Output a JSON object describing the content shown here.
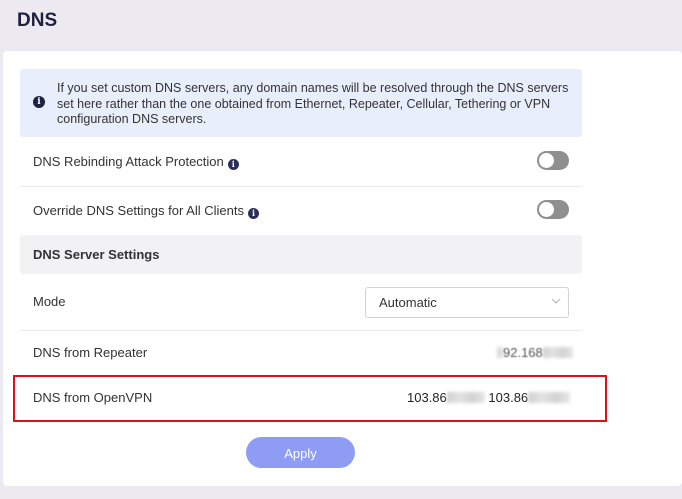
{
  "page": {
    "title": "DNS"
  },
  "info": {
    "icon": "info-circle-icon",
    "lines": [
      "If you set custom DNS servers, any domain names will be resolved through the DNS servers",
      "set here rather than the one obtained from Ethernet, Repeater, Cellular, Tethering or VPN",
      "configuration DNS servers."
    ]
  },
  "settings": {
    "rebinding": {
      "label": "DNS Rebinding Attack Protection",
      "enabled": false,
      "help_icon": "info-circle-icon"
    },
    "override": {
      "label": "Override DNS Settings for All Clients",
      "enabled": false,
      "help_icon": "info-circle-icon"
    }
  },
  "dns_server": {
    "heading": "DNS Server Settings",
    "mode": {
      "label": "Mode",
      "value": "Automatic"
    },
    "repeater": {
      "label": "DNS from Repeater",
      "value_prefix": "1",
      "value_visible": "92.168"
    },
    "openvpn": {
      "label": "DNS from OpenVPN",
      "value1_prefix": "103.86",
      "value2_prefix": "103.86"
    }
  },
  "actions": {
    "apply_label": "Apply"
  },
  "colors": {
    "toggle_off": "#8f8f8f",
    "accent": "#8f9cf3",
    "highlight": "#e0101a",
    "info_bg": "#e9eefc"
  }
}
